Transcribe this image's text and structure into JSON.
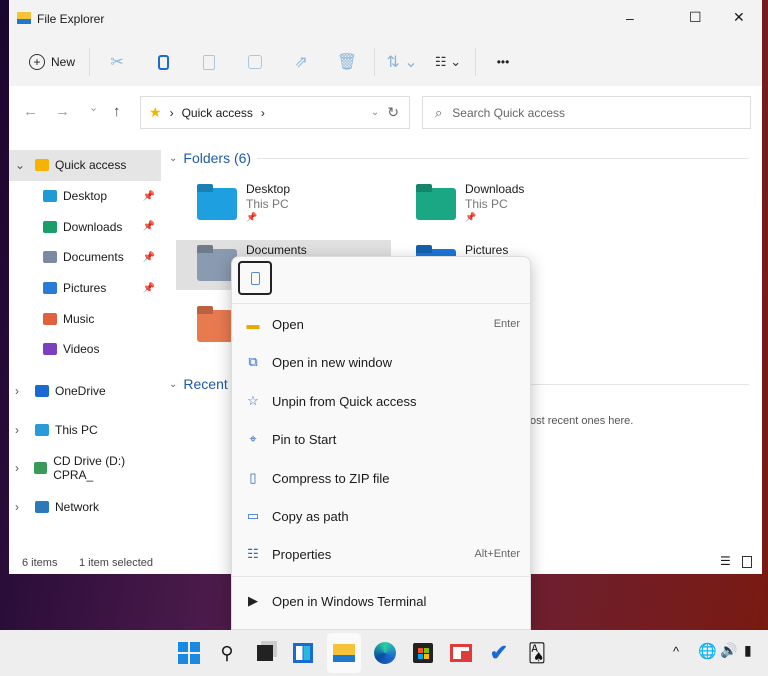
{
  "window": {
    "title": "File Explorer",
    "minimize": "–",
    "maximize": "☐",
    "close": "✕"
  },
  "toolbar": {
    "new_label": "New",
    "more": "•••"
  },
  "nav": {
    "back": "←",
    "forward": "→",
    "recent": "⌄",
    "up": "↑",
    "refresh": "↻"
  },
  "address": {
    "segments": [
      "Quick access"
    ],
    "sep": "›"
  },
  "search": {
    "placeholder": "Search Quick access"
  },
  "sidebar": {
    "items": [
      {
        "label": "Quick access",
        "color": "#f6b300",
        "pinned": false,
        "chev": "⌄"
      },
      {
        "label": "Desktop",
        "color": "#1e9ad6",
        "pinned": true
      },
      {
        "label": "Downloads",
        "color": "#1a9e6a",
        "pinned": true
      },
      {
        "label": "Documents",
        "color": "#7a8aa0",
        "pinned": true
      },
      {
        "label": "Pictures",
        "color": "#2a7ad8",
        "pinned": true
      },
      {
        "label": "Music",
        "color": "#e06040",
        "pinned": false
      },
      {
        "label": "Videos",
        "color": "#7a40c0",
        "pinned": false
      },
      {
        "label": "OneDrive",
        "color": "#1a6ad0",
        "chev": "›"
      },
      {
        "label": "This PC",
        "color": "#2a9ad8",
        "chev": "›"
      },
      {
        "label": "CD Drive (D:) CPRA_",
        "color": "#3a9a5a",
        "chev": "›"
      },
      {
        "label": "Network",
        "color": "#2a7ab8",
        "chev": "›"
      }
    ]
  },
  "main": {
    "folders_header": "Folders (6)",
    "folders": [
      {
        "name": "Desktop",
        "sub": "This PC",
        "color": "#1ea0e0"
      },
      {
        "name": "Downloads",
        "sub": "This PC",
        "color": "#1aa884"
      },
      {
        "name": "Documents",
        "sub": "",
        "color": "#8a9ab0"
      },
      {
        "name": "Pictures",
        "sub": "",
        "color": "#1a78d8"
      },
      {
        "name": "",
        "sub": "",
        "color": "#e87a50"
      }
    ],
    "recent_header": "Recent",
    "recent_text": "…ost recent ones here."
  },
  "status": {
    "items": "6 items",
    "selected": "1 item selected"
  },
  "context_menu": {
    "items": [
      {
        "label": "Open",
        "shortcut": "Enter",
        "icon": "folder-icon"
      },
      {
        "label": "Open in new window",
        "shortcut": "",
        "icon": "open-new-window-icon"
      },
      {
        "label": "Unpin from Quick access",
        "shortcut": "",
        "icon": "unpin-icon"
      },
      {
        "label": "Pin to Start",
        "shortcut": "",
        "icon": "pin-icon"
      },
      {
        "label": "Compress to ZIP file",
        "shortcut": "",
        "icon": "zip-icon"
      },
      {
        "label": "Copy as path",
        "shortcut": "",
        "icon": "copy-path-icon"
      },
      {
        "label": "Properties",
        "shortcut": "Alt+Enter",
        "icon": "properties-icon"
      },
      {
        "label": "Open in Windows Terminal",
        "shortcut": "",
        "icon": "terminal-icon"
      }
    ]
  }
}
